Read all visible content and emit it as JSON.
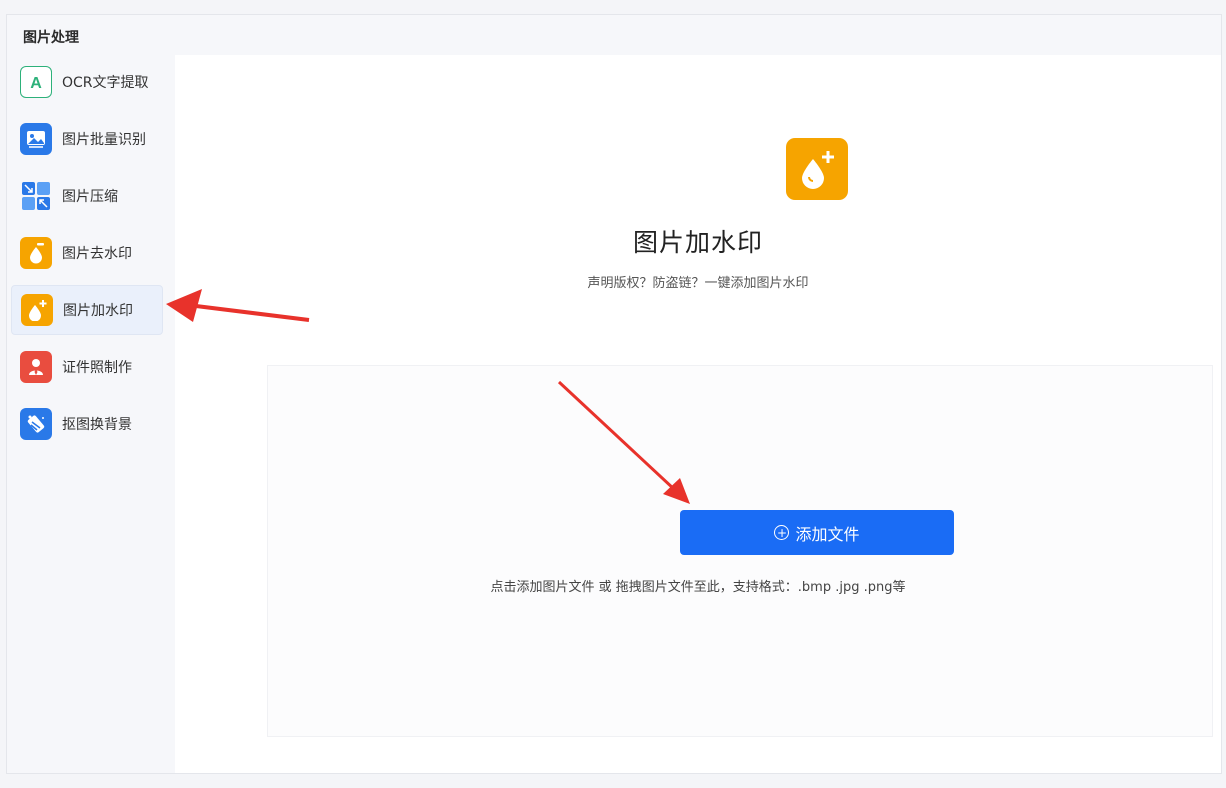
{
  "section": {
    "title": "图片处理"
  },
  "sidebar": {
    "items": [
      {
        "label": "OCR文字提取",
        "icon": "ocr-text-icon",
        "color": "#2db17a",
        "active": false
      },
      {
        "label": "图片批量识别",
        "icon": "image-batch-icon",
        "color": "#2a79e8",
        "active": false
      },
      {
        "label": "图片压缩",
        "icon": "compress-icon",
        "color": "#2a79e8",
        "active": false
      },
      {
        "label": "图片去水印",
        "icon": "remove-watermark-icon",
        "color": "#f6a400",
        "active": false
      },
      {
        "label": "图片加水印",
        "icon": "add-watermark-icon",
        "color": "#f6a400",
        "active": true
      },
      {
        "label": "证件照制作",
        "icon": "id-photo-icon",
        "color": "#e94d3f",
        "active": false
      },
      {
        "label": "抠图换背景",
        "icon": "cutout-icon",
        "color": "#2a79e8",
        "active": false
      }
    ]
  },
  "main": {
    "title": "图片加水印",
    "subtitle": "声明版权？防盗链？一键添加图片水印",
    "add_button": "添加文件",
    "hint": "点击添加图片文件 或 拖拽图片文件至此，支持格式：.bmp .jpg .png等"
  },
  "colors": {
    "accent": "#1a6cf5",
    "orange": "#f6a400",
    "annotation": "#e8322b"
  }
}
